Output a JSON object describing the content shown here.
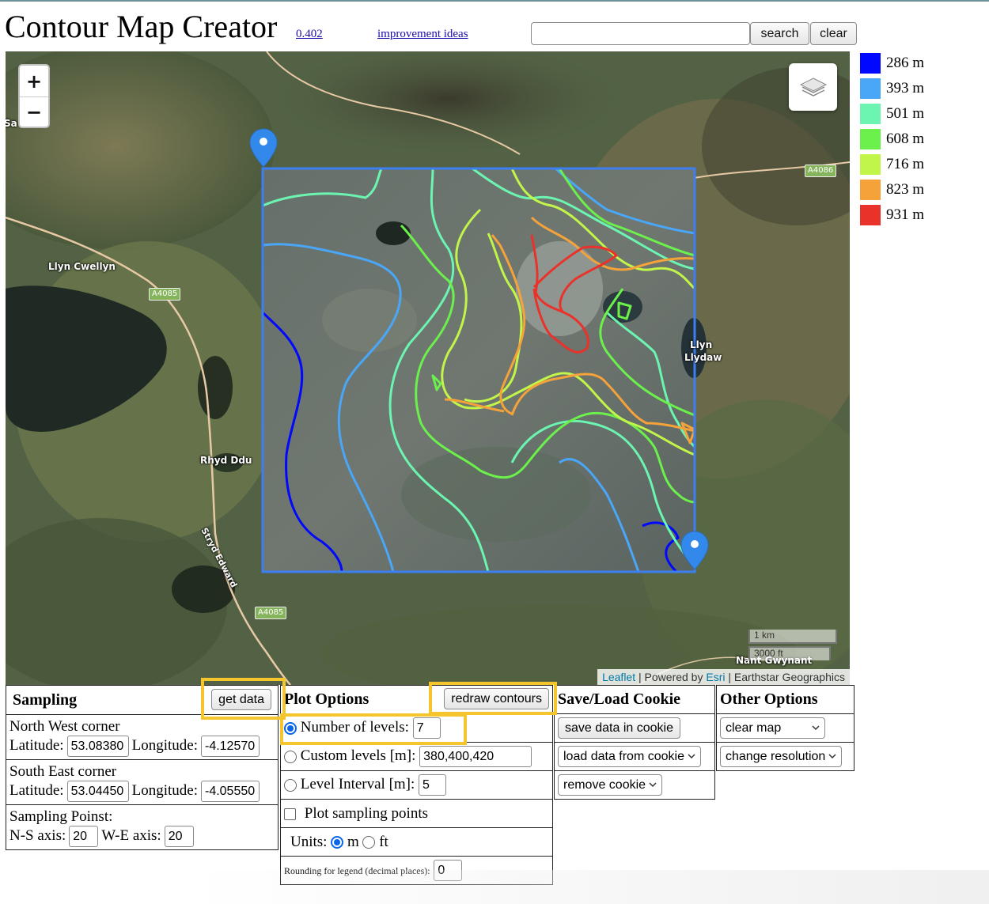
{
  "header": {
    "title": "Contour Map Creator",
    "version_link": "0.402",
    "improvement_link": "improvement ideas",
    "search_value": "",
    "search_button": "search",
    "clear_button": "clear"
  },
  "map": {
    "zoom_in": "+",
    "zoom_out": "−",
    "labels": {
      "lake_cwellyn": "Llyn Cwellyn",
      "lake_llydaw_1": "Llyn",
      "lake_llydaw_2": "Llydaw",
      "rhyd_ddu": "Rhyd Ddu",
      "stryd": "Stryd Edward",
      "nant": "Nant Gwynant",
      "edge_sa": "Sa"
    },
    "roads": [
      "A4085",
      "A4085",
      "A4086"
    ],
    "scale_km": "1 km",
    "scale_ft": "3000 ft",
    "attribution": {
      "leaflet": "Leaflet",
      "powered": "| Powered by",
      "esri": "Esri",
      "rest": "| Earthstar Geographics"
    }
  },
  "legend": [
    {
      "color": "#0008ff",
      "label": "286 m"
    },
    {
      "color": "#4aa6f6",
      "label": "393 m"
    },
    {
      "color": "#6cf5b0",
      "label": "501 m"
    },
    {
      "color": "#6cf04c",
      "label": "608 m"
    },
    {
      "color": "#c2f54a",
      "label": "716 m"
    },
    {
      "color": "#f5a23a",
      "label": "823 m"
    },
    {
      "color": "#e8322a",
      "label": "931 m"
    }
  ],
  "sampling": {
    "title": "Sampling",
    "get_data": "get data",
    "nw_label": "North West corner",
    "lat_label": "Latitude:",
    "lon_label": "Longitude:",
    "nw_lat": "53.08380",
    "nw_lon": "-4.12570",
    "se_label": "South East corner",
    "se_lat": "53.04450",
    "se_lon": "-4.05550",
    "points_label": "Sampling Poinst:",
    "ns_label": "N-S axis:",
    "ns_value": "20",
    "we_label": "W-E axis:",
    "we_value": "20"
  },
  "plot": {
    "title": "Plot Options",
    "redraw": "redraw contours",
    "levels_label": "Number of levels:",
    "levels_value": "7",
    "custom_label": "Custom levels [m]:",
    "custom_value": "380,400,420",
    "interval_label": "Level Interval [m]:",
    "interval_value": "5",
    "sampling_points_label": "Plot sampling points",
    "units_label": "Units:",
    "unit_m": "m",
    "unit_ft": "ft",
    "rounding_label": "Rounding for legend (decimal places):",
    "rounding_value": "0"
  },
  "cookie": {
    "title": "Save/Load Cookie",
    "save": "save data in cookie",
    "load": "load data from cookie",
    "remove": "remove cookie"
  },
  "other": {
    "title": "Other Options",
    "clear_map": "clear map",
    "change_resolution": "change resolution"
  }
}
